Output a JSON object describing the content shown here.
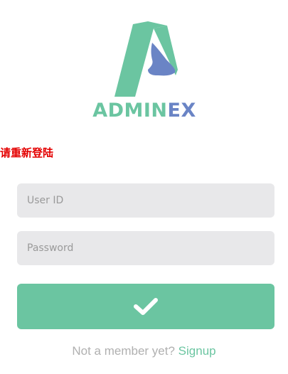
{
  "brand": {
    "part1": "ADMIN",
    "part2": "EX",
    "color_primary": "#6bc5a1",
    "color_secondary": "#6a84c5"
  },
  "alert": {
    "message": "请重新登陆",
    "color": "#e40000"
  },
  "form": {
    "user_id_placeholder": "User ID",
    "password_placeholder": "Password",
    "user_id_value": "",
    "password_value": "",
    "submit_icon": "check-icon"
  },
  "footer": {
    "prompt": "Not a member yet?",
    "signup_link": "Signup"
  }
}
